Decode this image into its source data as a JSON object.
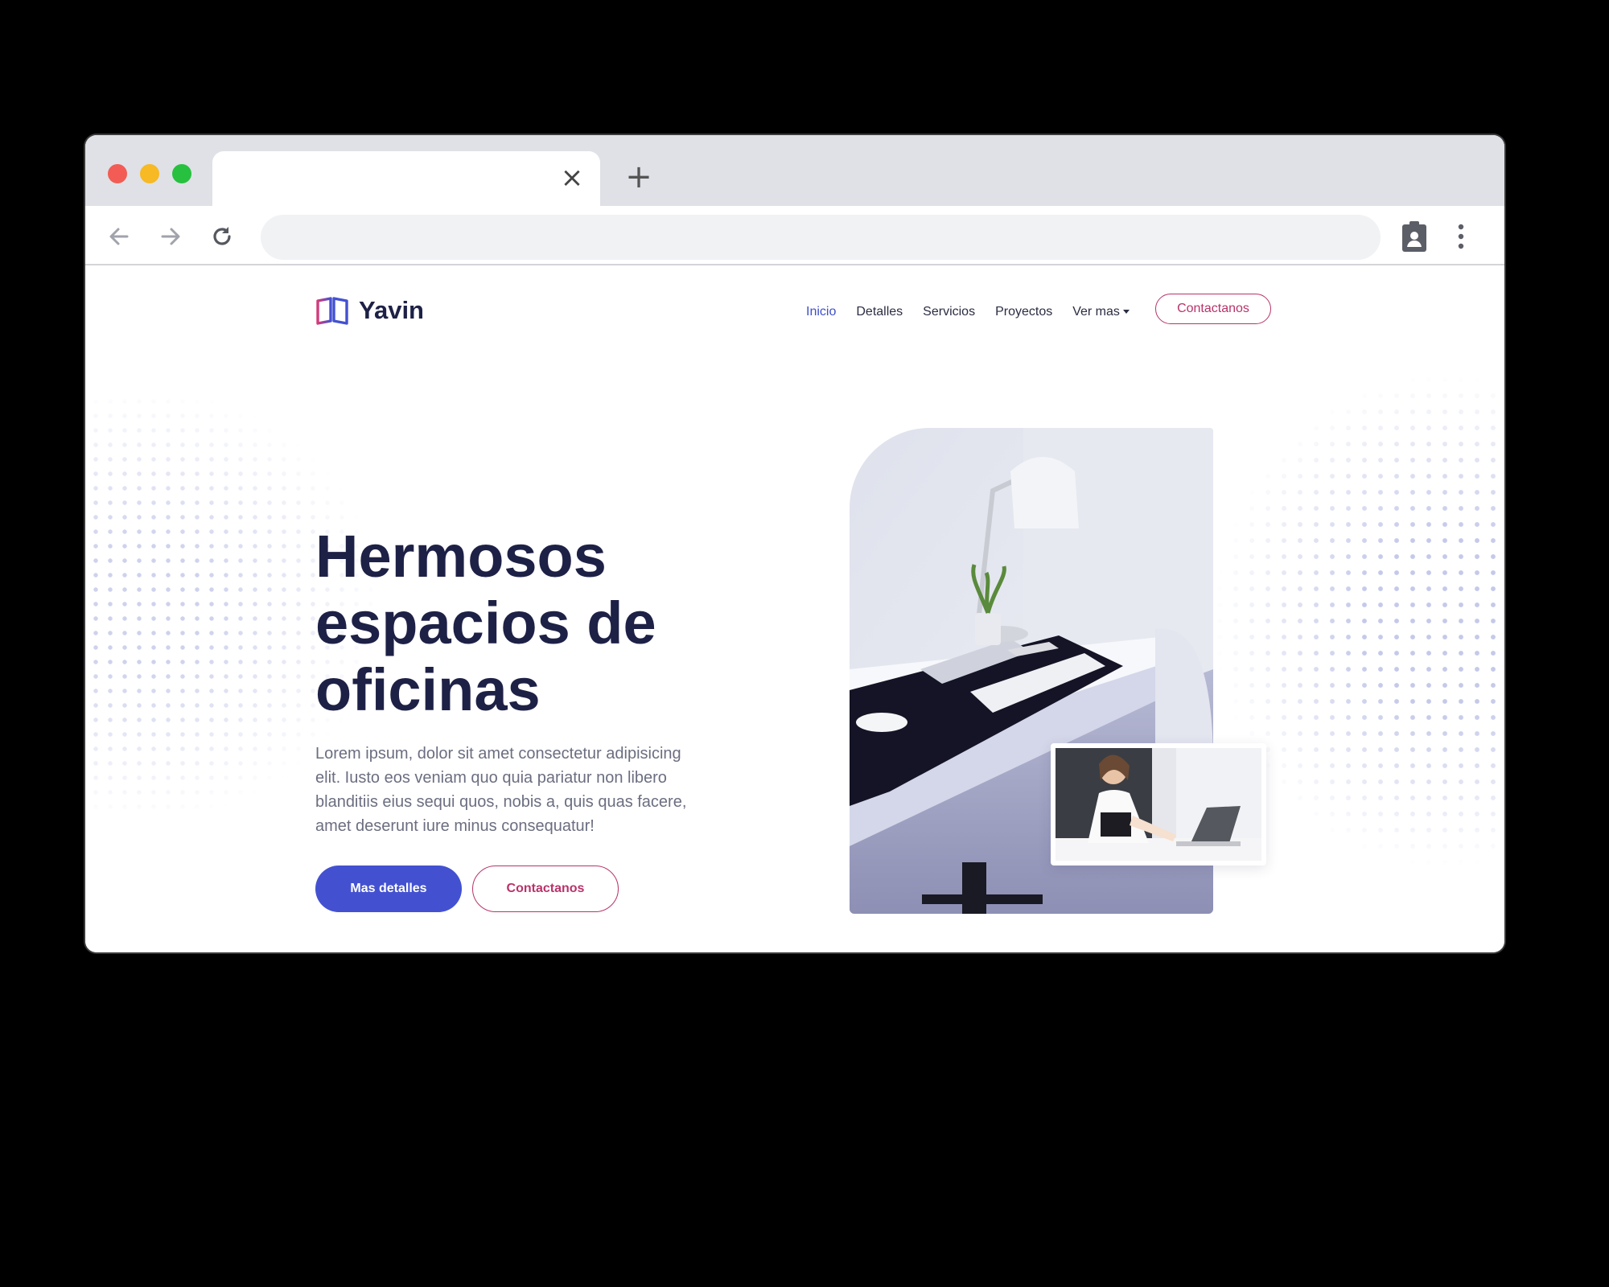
{
  "browser": {
    "tab_close_glyph": "×",
    "new_tab_glyph": "+",
    "address_value": ""
  },
  "site": {
    "logo_text": "Yavin",
    "nav": [
      {
        "label": "Inicio",
        "active": true
      },
      {
        "label": "Detalles",
        "active": false
      },
      {
        "label": "Servicios",
        "active": false
      },
      {
        "label": "Proyectos",
        "active": false
      },
      {
        "label": "Ver mas",
        "active": false
      }
    ],
    "nav_cta": "Contactanos"
  },
  "hero": {
    "title": "Hermosos espacios de oficinas",
    "text": "Lorem ipsum, dolor sit amet consectetur adipisicing elit. Iusto eos veniam quo quia pariatur non libero blanditiis eius sequi quos, nobis a, quis quas facere, amet deserunt iure minus consequatur!",
    "primary_button": "Mas detalles",
    "secondary_button": "Contactanos"
  },
  "colors": {
    "primary": "#4351d1",
    "accent": "#b8336a",
    "heading": "#1e2146"
  }
}
